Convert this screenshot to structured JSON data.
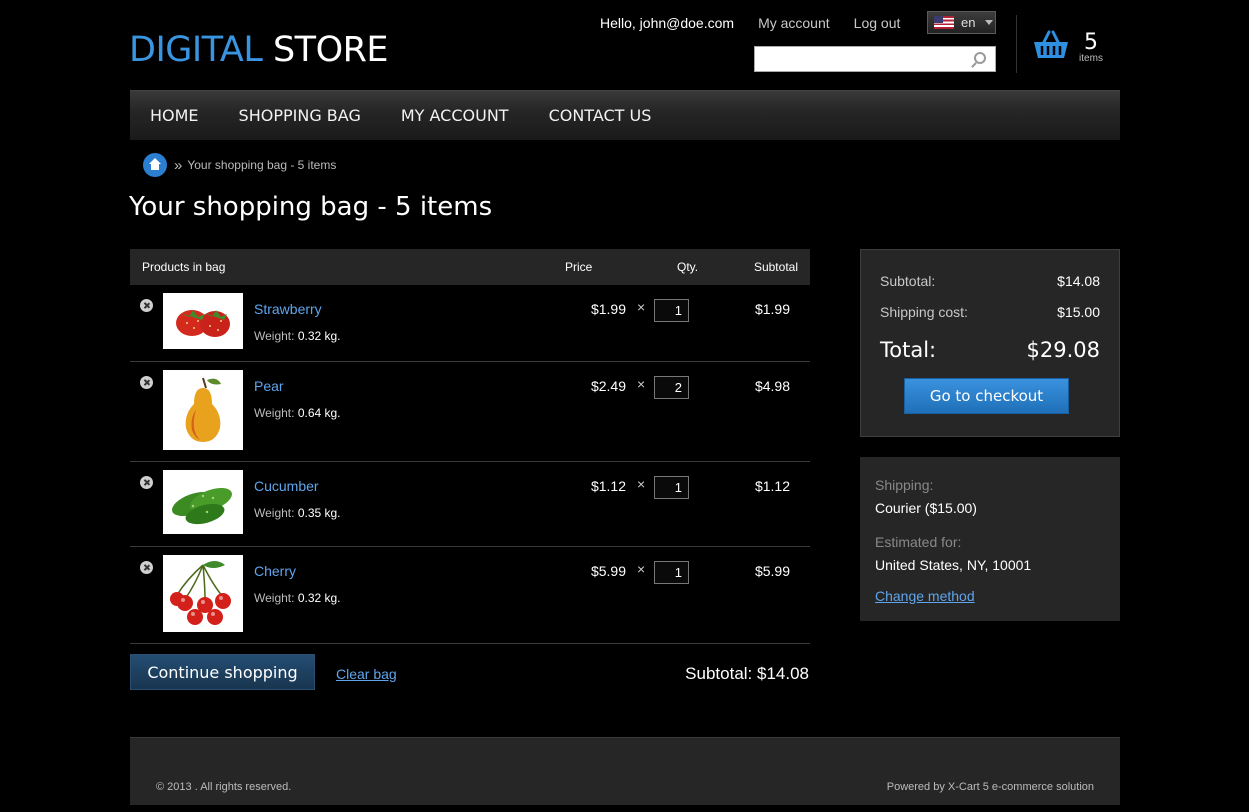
{
  "logo": {
    "part1": "DIGITAL",
    "part2": "STORE"
  },
  "topbar": {
    "greeting": "Hello, john@doe.com",
    "my_account": "My account",
    "logout": "Log out",
    "language": "en"
  },
  "search": {
    "value": "",
    "placeholder": ""
  },
  "cart_widget": {
    "count": "5",
    "label": "items"
  },
  "nav": [
    "HOME",
    "SHOPPING BAG",
    "MY ACCOUNT",
    "CONTACT US"
  ],
  "breadcrumb": {
    "current": "Your shopping bag - 5 items"
  },
  "page_title": "Your shopping bag - 5 items",
  "table": {
    "headers": {
      "products": "Products in bag",
      "price": "Price",
      "qty": "Qty.",
      "subtotal": "Subtotal"
    },
    "rows": [
      {
        "name": "Strawberry",
        "weight_label": "Weight:",
        "weight": "0.32 kg.",
        "price": "$1.99",
        "qty": "1",
        "subtotal": "$1.99"
      },
      {
        "name": "Pear",
        "weight_label": "Weight:",
        "weight": "0.64 kg.",
        "price": "$2.49",
        "qty": "2",
        "subtotal": "$4.98"
      },
      {
        "name": "Cucumber",
        "weight_label": "Weight:",
        "weight": "0.35 kg.",
        "price": "$1.12",
        "qty": "1",
        "subtotal": "$1.12"
      },
      {
        "name": "Cherry",
        "weight_label": "Weight:",
        "weight": "0.32 kg.",
        "price": "$5.99",
        "qty": "1",
        "subtotal": "$5.99"
      }
    ]
  },
  "actions": {
    "continue": "Continue shopping",
    "clear": "Clear bag",
    "subtotal": "Subtotal: $14.08"
  },
  "totals": {
    "subtotal_label": "Subtotal:",
    "subtotal": "$14.08",
    "shipping_label": "Shipping cost:",
    "shipping": "$15.00",
    "total_label": "Total:",
    "total": "$29.08",
    "checkout": "Go to checkout"
  },
  "shipping_box": {
    "shipping_label": "Shipping:",
    "shipping_value": "Courier ($15.00)",
    "estimated_label": "Estimated for:",
    "estimated_value": "United States, NY, 10001",
    "change": "Change method"
  },
  "footer": {
    "copyright": "© 2013 . All rights reserved.",
    "powered": "Powered by X-Cart 5 e-commerce solution"
  },
  "colors": {
    "accent": "#3a95e0",
    "link": "#5fa5ec",
    "panel": "#262626",
    "background": "#000000"
  }
}
